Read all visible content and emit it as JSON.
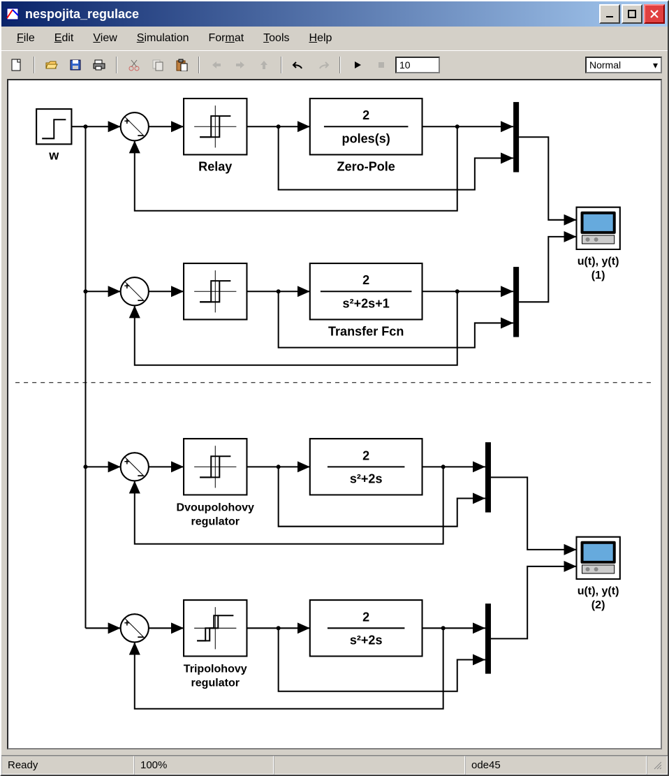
{
  "window": {
    "title": "nespojita_regulace"
  },
  "menu": {
    "file": "File",
    "edit": "Edit",
    "view": "View",
    "simulation": "Simulation",
    "format": "Format",
    "tools": "Tools",
    "help": "Help"
  },
  "toolbar": {
    "sim_time": "10",
    "mode_selected": "Normal",
    "icons": {
      "new": "new",
      "open": "open",
      "save": "save",
      "print": "print",
      "cut": "cut",
      "copy": "copy",
      "paste": "paste",
      "back": "back",
      "forward": "forward",
      "up": "up",
      "undo": "undo",
      "redo": "redo",
      "play": "play",
      "stop": "stop"
    }
  },
  "diagram": {
    "source": {
      "label": "w"
    },
    "loop1": {
      "relay_label": "Relay",
      "tf_num": "2",
      "tf_den": "poles(s)",
      "tf_label": "Zero-Pole"
    },
    "loop2": {
      "tf_num": "2",
      "tf_den": "s²+2s+1",
      "tf_label": "Transfer Fcn"
    },
    "scope1": {
      "label": "u(t), y(t)",
      "index": "(1)"
    },
    "loop3": {
      "reg_label_1": "Dvoupolohovy",
      "reg_label_2": "regulator",
      "tf_num": "2",
      "tf_den": "s²+2s"
    },
    "loop4": {
      "reg_label_1": "Tripolohovy",
      "reg_label_2": "regulator",
      "tf_num": "2",
      "tf_den": "s²+2s"
    },
    "scope2": {
      "label": "u(t), y(t)",
      "index": "(2)"
    }
  },
  "statusbar": {
    "state": "Ready",
    "zoom": "100%",
    "solver": "ode45"
  }
}
